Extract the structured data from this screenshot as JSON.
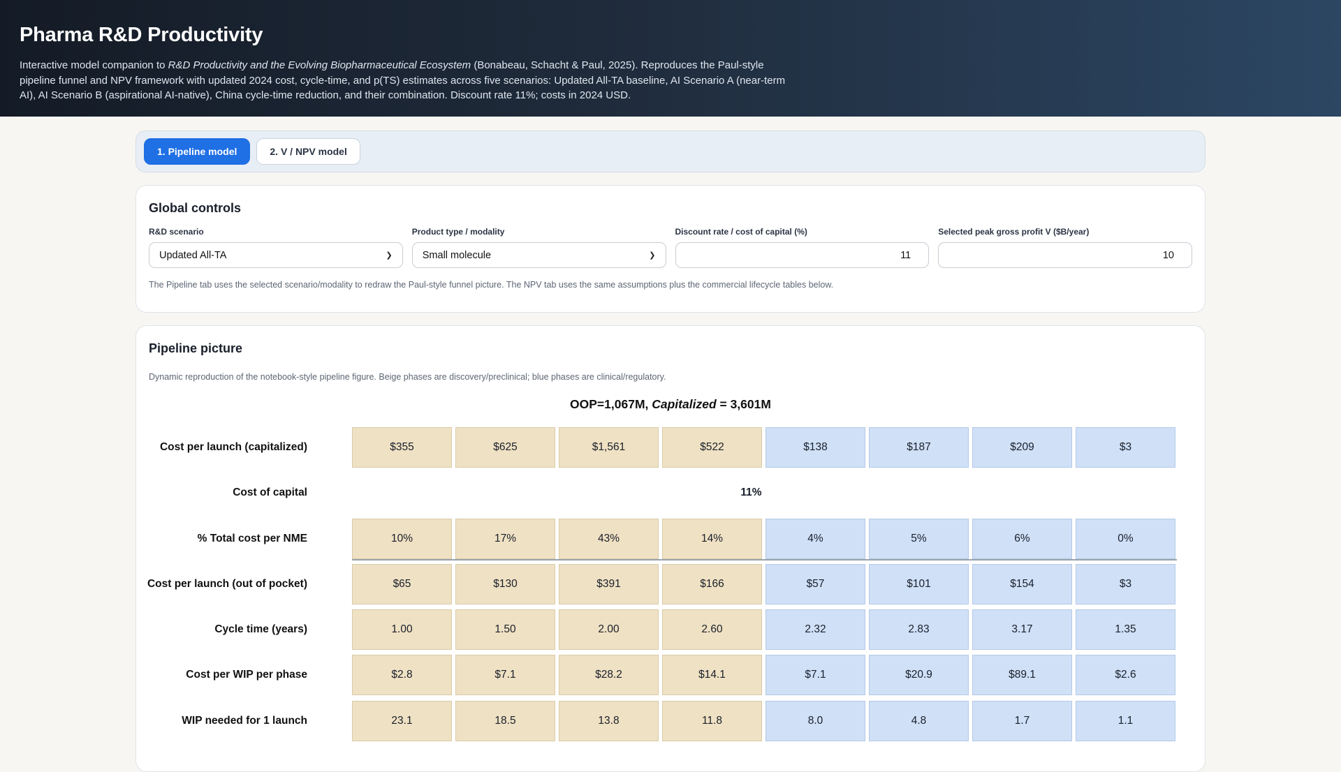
{
  "header": {
    "title": "Pharma R&D Productivity",
    "desc_pre": "Interactive model companion to ",
    "desc_italic": "R&D Productivity and the Evolving Biopharmaceutical Ecosystem",
    "desc_post": " (Bonabeau, Schacht & Paul, 2025). Reproduces the Paul-style pipeline funnel and NPV framework with updated 2024 cost, cycle-time, and p(TS) estimates across five scenarios: Updated All-TA baseline, AI Scenario A (near-term AI), AI Scenario B (aspirational AI-native), China cycle-time reduction, and their combination. Discount rate 11%; costs in 2024 USD."
  },
  "tabs": [
    {
      "label": "1. Pipeline model",
      "active": true
    },
    {
      "label": "2. V / NPV model",
      "active": false
    }
  ],
  "controls": {
    "title": "Global controls",
    "scenario_label": "R&D scenario",
    "scenario_value": "Updated All-TA",
    "modality_label": "Product type / modality",
    "modality_value": "Small molecule",
    "discount_label": "Discount rate / cost of capital (%)",
    "discount_value": "11",
    "peak_label": "Selected peak gross profit V ($B/year)",
    "peak_value": "10",
    "note": "The Pipeline tab uses the selected scenario/modality to redraw the Paul-style funnel picture. The NPV tab uses the same assumptions plus the commercial lifecycle tables below."
  },
  "pipeline": {
    "title": "Pipeline picture",
    "subtitle": "Dynamic reproduction of the notebook-style pipeline figure. Beige phases are discovery/preclinical; blue phases are clinical/regulatory.",
    "oop_prefix": "OOP=1,067M, ",
    "oop_italic": "Capitalized",
    "oop_suffix": " = 3,601M",
    "phase_kinds": [
      "beige",
      "beige",
      "beige",
      "beige",
      "blue",
      "blue",
      "blue",
      "blue"
    ],
    "cost_of_capital_label": "Cost of capital",
    "cost_of_capital_value": "11%",
    "rows": [
      {
        "label": "Cost per launch (capitalized)",
        "values": [
          "$355",
          "$625",
          "$1,561",
          "$522",
          "$138",
          "$187",
          "$209",
          "$3"
        ]
      },
      {
        "label": "% Total cost per NME",
        "values": [
          "10%",
          "17%",
          "43%",
          "14%",
          "4%",
          "5%",
          "6%",
          "0%"
        ]
      },
      {
        "label": "Cost per launch (out of pocket)",
        "values": [
          "$65",
          "$130",
          "$391",
          "$166",
          "$57",
          "$101",
          "$154",
          "$3"
        ]
      },
      {
        "label": "Cycle time (years)",
        "values": [
          "1.00",
          "1.50",
          "2.00",
          "2.60",
          "2.32",
          "2.83",
          "3.17",
          "1.35"
        ]
      },
      {
        "label": "Cost per WIP per phase",
        "values": [
          "$2.8",
          "$7.1",
          "$28.2",
          "$14.1",
          "$7.1",
          "$20.9",
          "$89.1",
          "$2.6"
        ]
      },
      {
        "label": "WIP needed for 1 launch",
        "values": [
          "23.1",
          "18.5",
          "13.8",
          "11.8",
          "8.0",
          "4.8",
          "1.7",
          "1.1"
        ]
      }
    ]
  }
}
